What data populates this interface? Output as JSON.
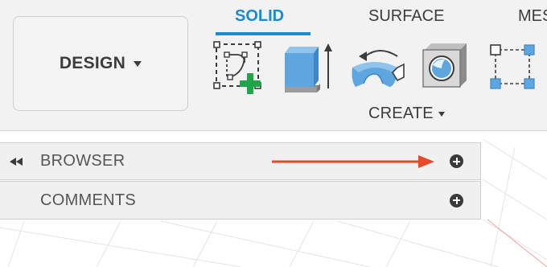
{
  "toolbar": {
    "workspace_label": "DESIGN",
    "tabs": [
      {
        "label": "SOLID",
        "active": true
      },
      {
        "label": "SURFACE",
        "active": false
      },
      {
        "label": "MES",
        "active": false
      }
    ],
    "tools": [
      {
        "name": "create-sketch",
        "icon": "sketch-plus-icon"
      },
      {
        "name": "extrude",
        "icon": "extrude-icon"
      },
      {
        "name": "revolve",
        "icon": "revolve-icon"
      },
      {
        "name": "hole",
        "icon": "hole-icon"
      },
      {
        "name": "pattern",
        "icon": "pattern-icon"
      }
    ],
    "group_label": "CREATE"
  },
  "panels": {
    "browser": {
      "label": "BROWSER"
    },
    "comments": {
      "label": "COMMENTS"
    }
  },
  "colors": {
    "accent": "#1a8ad2",
    "toolbar_bg": "#f2f2f2",
    "panel_bg": "#f0f0f0",
    "annotation_arrow": "#e8472a",
    "sketch_plus": "#1fa64a",
    "solid_blue": "#5da6e0"
  }
}
